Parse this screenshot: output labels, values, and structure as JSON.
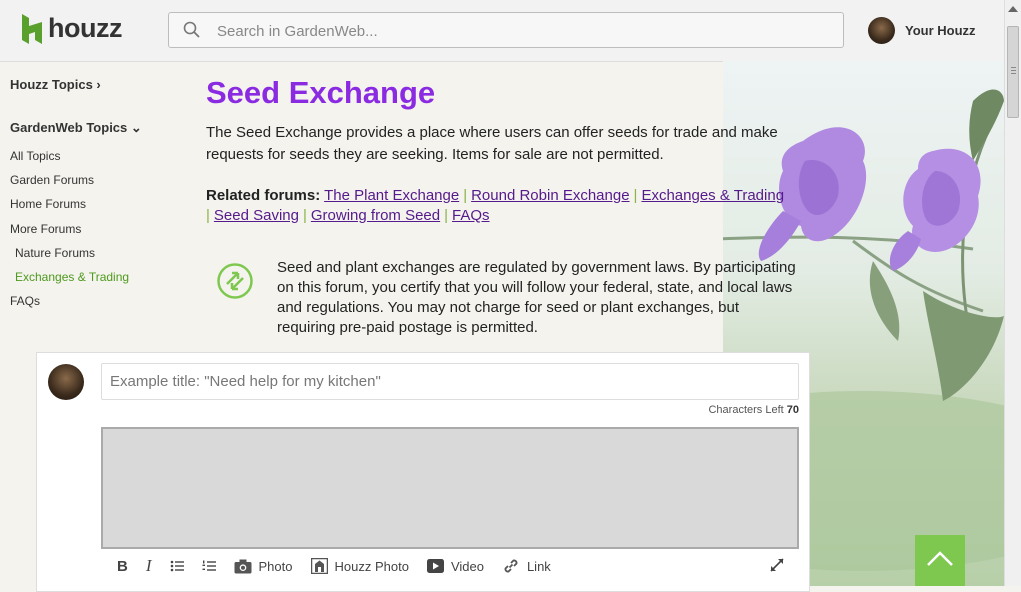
{
  "header": {
    "logo_text": "houzz",
    "search_placeholder": "Search in GardenWeb...",
    "user_label": "Your Houzz"
  },
  "sidebar": {
    "houzz_topics": "Houzz Topics ›",
    "gardenweb_topics": "GardenWeb Topics ⌄",
    "items": [
      {
        "label": "All Topics"
      },
      {
        "label": "Garden Forums"
      },
      {
        "label": "Home Forums"
      },
      {
        "label": "More Forums"
      },
      {
        "label": "Nature Forums"
      },
      {
        "label": "Exchanges & Trading"
      },
      {
        "label": "FAQs"
      }
    ]
  },
  "main": {
    "title": "Seed Exchange",
    "description": "The Seed Exchange provides a place where users can offer seeds for trade and make requests for seeds they are seeking. Items for sale are not permitted.",
    "related_label": "Related forums:",
    "related_links": [
      {
        "label": "The Plant Exchange"
      },
      {
        "label": "Round Robin Exchange"
      },
      {
        "label": "Exchanges & Trading"
      },
      {
        "label": "Seed Saving"
      },
      {
        "label": "Growing from Seed"
      },
      {
        "label": "FAQs"
      }
    ],
    "notice": "Seed and plant exchanges are regulated by government laws. By participating on this forum, you certify that you will follow your federal, state, and local laws and regulations. You may not charge for seed or plant exchanges, but requiring pre-paid postage is permitted."
  },
  "composer": {
    "title_placeholder": "Example title: \"Need help for my kitchen\"",
    "chars_label": "Characters Left",
    "chars_left": "70",
    "toolbar": {
      "bold": "B",
      "italic": "I",
      "photo": "Photo",
      "houzz_photo": "Houzz Photo",
      "video": "Video",
      "link": "Link"
    }
  },
  "colors": {
    "title": "#8a2be2",
    "accent_green": "#7ec850",
    "link": "#551a8b"
  }
}
